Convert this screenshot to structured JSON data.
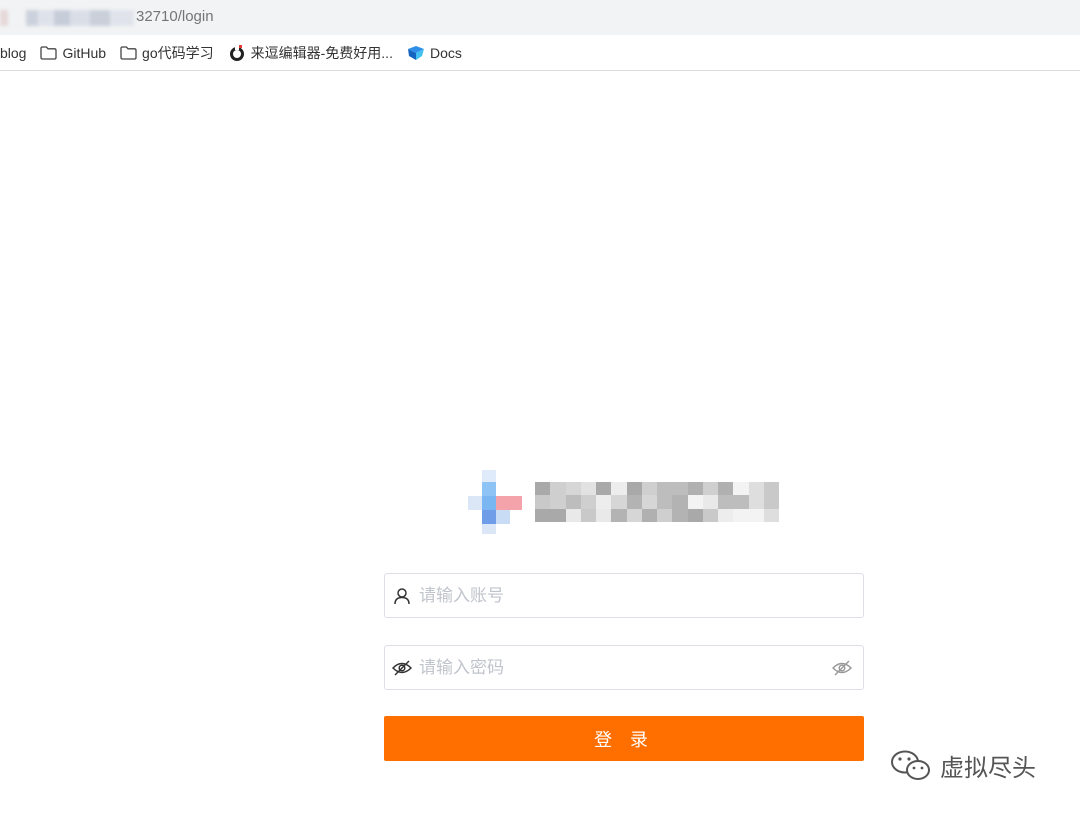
{
  "browser": {
    "url_visible": "32710/login"
  },
  "bookmarks": [
    {
      "label": "blog",
      "icon": "none"
    },
    {
      "label": "GitHub",
      "icon": "folder-icon"
    },
    {
      "label": "go代码学习",
      "icon": "folder-icon"
    },
    {
      "label": "来逗编辑器-免费好用...",
      "icon": "editor-logo-icon"
    },
    {
      "label": "Docs",
      "icon": "docs-logo-icon"
    }
  ],
  "login": {
    "username_placeholder": "请输入账号",
    "password_placeholder": "请输入密码",
    "submit_label": "登 录"
  },
  "colors": {
    "accent": "#ff6f00",
    "input_border": "#dcdfe6",
    "placeholder": "#c0c4cc"
  },
  "watermark": {
    "text": "虚拟尽头",
    "icon": "wechat-icon"
  }
}
